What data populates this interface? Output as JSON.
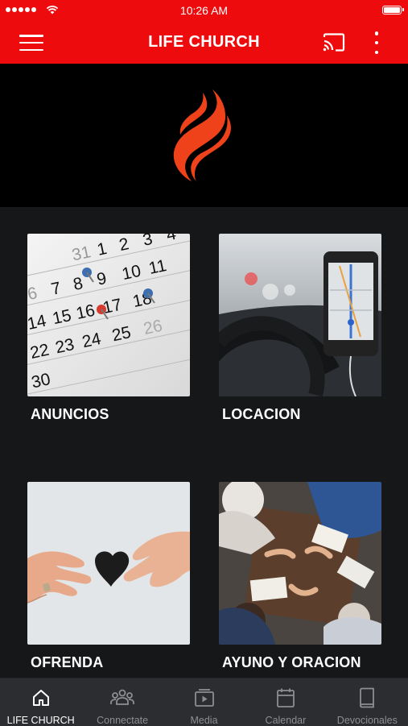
{
  "status_bar": {
    "time": "10:26 AM"
  },
  "app_bar": {
    "title": "LIFE CHURCH"
  },
  "tiles": [
    {
      "label": "ANUNCIOS",
      "image": "calendar-photo"
    },
    {
      "label": "LOCACION",
      "image": "car-gps-photo"
    },
    {
      "label": "OFRENDA",
      "image": "hands-heart-photo"
    },
    {
      "label": "AYUNO Y ORACION",
      "image": "praying-group-photo"
    }
  ],
  "tabs": [
    {
      "label": "LIFE CHURCH",
      "icon": "home-icon",
      "active": true
    },
    {
      "label": "Connectate",
      "icon": "people-icon",
      "active": false
    },
    {
      "label": "Media",
      "icon": "media-icon",
      "active": false
    },
    {
      "label": "Calendar",
      "icon": "calendar-icon",
      "active": false
    },
    {
      "label": "Devocionales",
      "icon": "book-icon",
      "active": false
    }
  ],
  "colors": {
    "brand_red": "#ee0b0d",
    "background": "#161719",
    "tabbar": "#2c2d30",
    "flame": "#f0421a"
  }
}
